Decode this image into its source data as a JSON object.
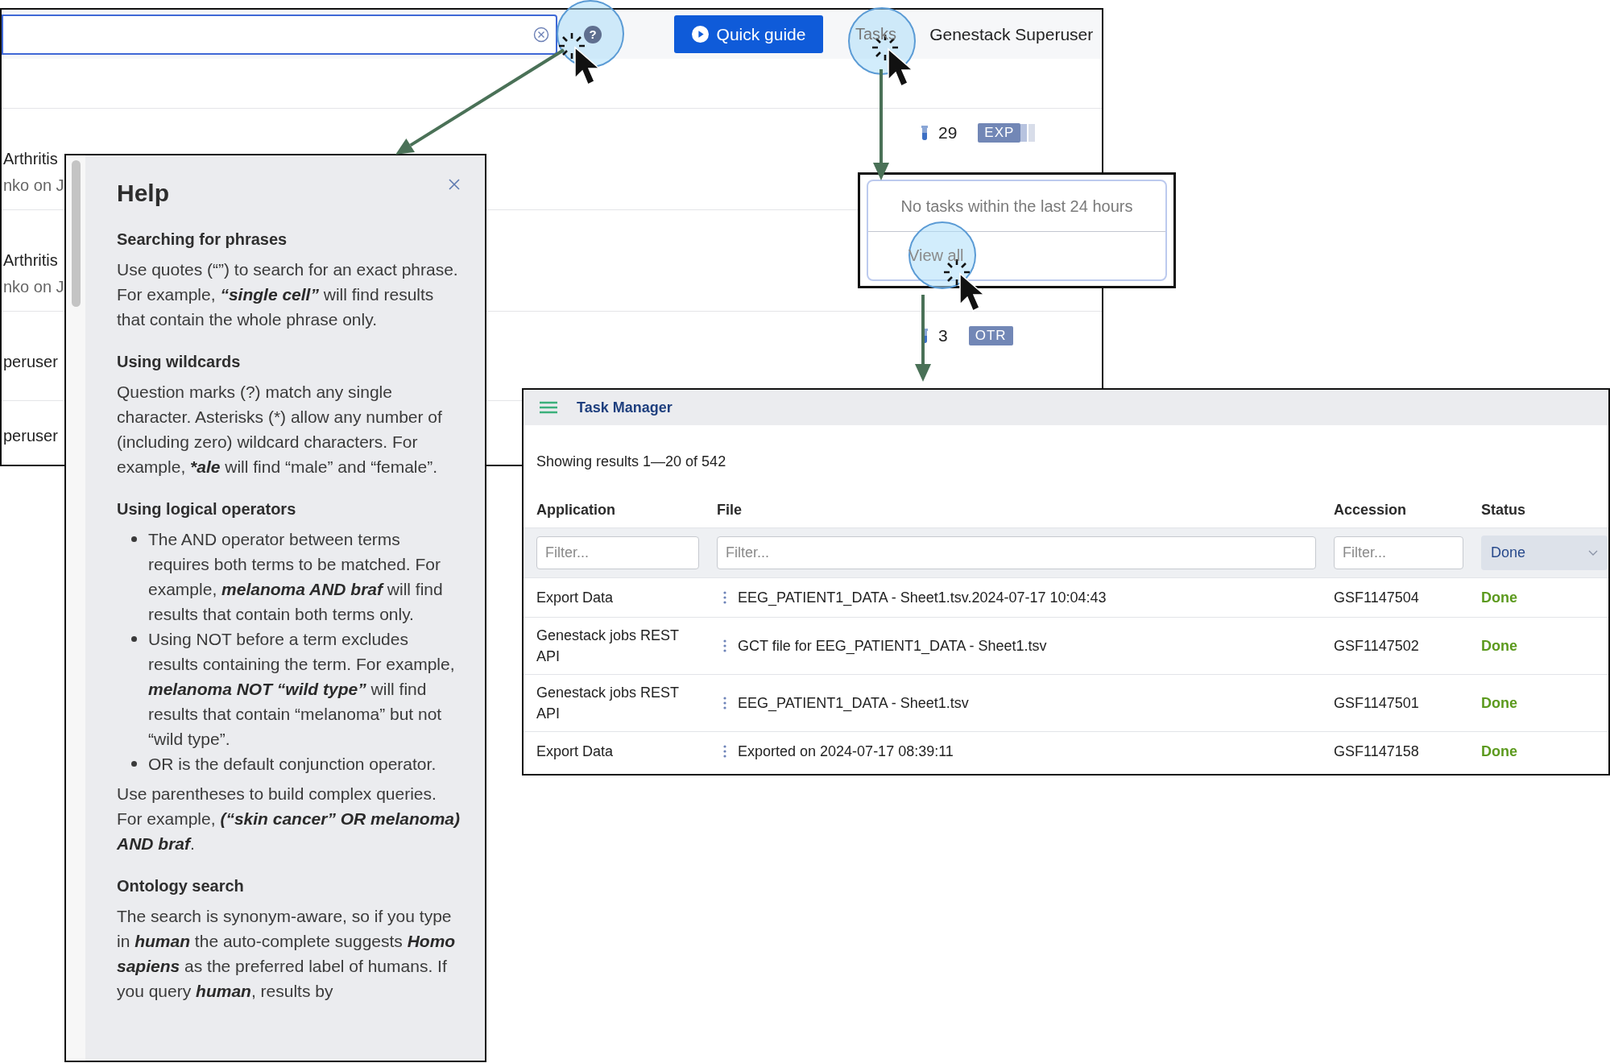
{
  "main_page": {
    "help_button": "?",
    "quick_guide_button": "Quick guide",
    "tasks_link": "Tasks",
    "user_name": "Genestack Superuser",
    "rows": [
      {
        "title": "Arthritis",
        "subtitle": "nko on J",
        "count": "29",
        "tag": "EXP"
      },
      {
        "title": "Arthritis",
        "subtitle": "nko on J"
      },
      {
        "title": "peruser",
        "count": "3",
        "tag": "OTR"
      },
      {
        "title": "peruser"
      }
    ]
  },
  "help_panel": {
    "title": "Help",
    "sections": [
      {
        "heading": "Searching for phrases",
        "blocks": [
          {
            "kind": "paragraph",
            "runs": [
              {
                "text": "Use quotes (“”) to search for an exact phrase. For example, ",
                "italic": false
              },
              {
                "text": "“single cell”",
                "italic": true
              },
              {
                "text": " will find results that contain the whole phrase only.",
                "italic": false
              }
            ]
          }
        ]
      },
      {
        "heading": "Using wildcards",
        "blocks": [
          {
            "kind": "paragraph",
            "runs": [
              {
                "text": "Question marks (?) match any single character. Asterisks (*) allow any number of (including zero) wildcard characters. For example, ",
                "italic": false
              },
              {
                "text": "*ale",
                "italic": true
              },
              {
                "text": " will find “male” and “female”.",
                "italic": false
              }
            ]
          }
        ]
      },
      {
        "heading": "Using logical operators",
        "blocks": [
          {
            "kind": "bullets",
            "items": [
              {
                "runs": [
                  {
                    "text": "The AND operator between terms requires both terms to be matched. For example, ",
                    "italic": false
                  },
                  {
                    "text": "melanoma AND braf",
                    "italic": true
                  },
                  {
                    "text": " will find results that contain both terms only.",
                    "italic": false
                  }
                ]
              },
              {
                "runs": [
                  {
                    "text": "Using NOT before a term excludes results containing the term. For example, ",
                    "italic": false
                  },
                  {
                    "text": "melanoma NOT “wild type”",
                    "italic": true
                  },
                  {
                    "text": " will find results that contain “melanoma” but not “wild type”.",
                    "italic": false
                  }
                ]
              },
              {
                "runs": [
                  {
                    "text": "OR is the default conjunction operator.",
                    "italic": false
                  }
                ]
              }
            ]
          },
          {
            "kind": "paragraph",
            "runs": [
              {
                "text": "Use parentheses to build complex queries. For example, ",
                "italic": false
              },
              {
                "text": "(“skin cancer” OR melanoma) AND braf",
                "italic": true
              },
              {
                "text": ".",
                "italic": false
              }
            ]
          }
        ]
      },
      {
        "heading": "Ontology search",
        "blocks": [
          {
            "kind": "paragraph",
            "runs": [
              {
                "text": "The search is synonym-aware, so if you type in ",
                "italic": false
              },
              {
                "text": "human",
                "italic": true
              },
              {
                "text": " the auto-complete suggests ",
                "italic": false
              },
              {
                "text": "Homo sapiens",
                "italic": true
              },
              {
                "text": " as the preferred label of humans. If you query ",
                "italic": false
              },
              {
                "text": "human",
                "italic": true
              },
              {
                "text": ", results by",
                "italic": false
              }
            ]
          }
        ]
      }
    ]
  },
  "tasks_popup": {
    "message": "No tasks within the last 24 hours",
    "link": "View all"
  },
  "task_manager": {
    "title": "Task Manager",
    "summary": "Showing results 1—20 of 542",
    "columns": [
      {
        "label": "Application",
        "kind": "text",
        "placeholder": "Filter..."
      },
      {
        "label": "File",
        "kind": "text",
        "placeholder": "Filter..."
      },
      {
        "label": "Accession",
        "kind": "text",
        "placeholder": "Filter..."
      },
      {
        "label": "Status",
        "kind": "select",
        "value": "Done"
      }
    ],
    "rows": [
      {
        "application": "Export Data",
        "file": "EEG_PATIENT1_DATA - Sheet1.tsv.2024-07-17 10:04:43",
        "accession": "GSF1147504",
        "status": "Done"
      },
      {
        "application": "Genestack jobs REST API",
        "file": "GCT file for EEG_PATIENT1_DATA - Sheet1.tsv",
        "accession": "GSF1147502",
        "status": "Done"
      },
      {
        "application": "Genestack jobs REST API",
        "file": "EEG_PATIENT1_DATA - Sheet1.tsv",
        "accession": "GSF1147501",
        "status": "Done"
      },
      {
        "application": "Export Data",
        "file": "Exported on 2024-07-17 08:39:11",
        "accession": "GSF1147158",
        "status": "Done"
      }
    ]
  }
}
